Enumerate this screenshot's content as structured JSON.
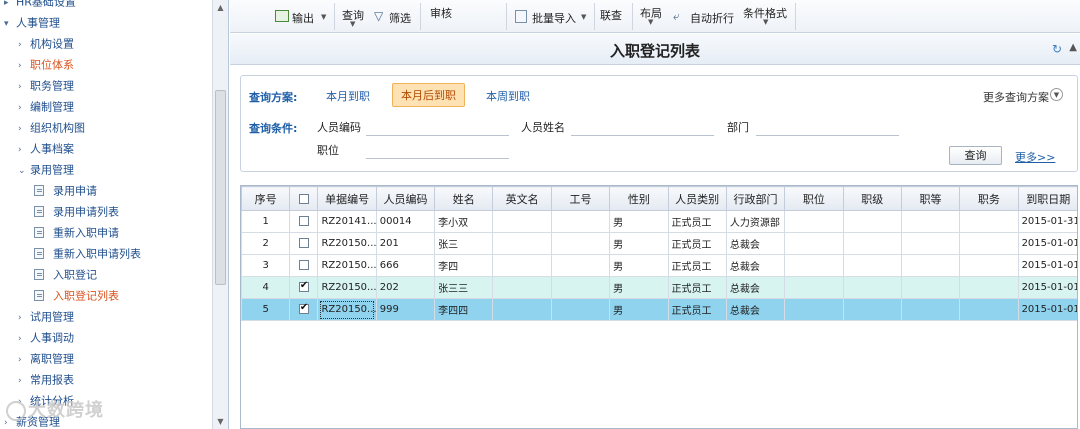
{
  "sidebar": {
    "items": [
      {
        "label": "HR基础设置",
        "level": 0,
        "arrow": "▸",
        "type": "group"
      },
      {
        "label": "人事管理",
        "level": 0,
        "arrow": "▾",
        "type": "group"
      },
      {
        "label": "机构设置",
        "level": 1,
        "arrow": "›",
        "type": "group"
      },
      {
        "label": "职位体系",
        "level": 1,
        "arrow": "›",
        "type": "group",
        "active": true
      },
      {
        "label": "职务管理",
        "level": 1,
        "arrow": "›",
        "type": "group"
      },
      {
        "label": "编制管理",
        "level": 1,
        "arrow": "›",
        "type": "group"
      },
      {
        "label": "组织机构图",
        "level": 1,
        "arrow": "›",
        "type": "group"
      },
      {
        "label": "人事档案",
        "level": 1,
        "arrow": "›",
        "type": "group"
      },
      {
        "label": "录用管理",
        "level": 1,
        "arrow": "⌄",
        "type": "group"
      },
      {
        "label": "录用申请",
        "level": 2,
        "type": "doc"
      },
      {
        "label": "录用申请列表",
        "level": 2,
        "type": "doc"
      },
      {
        "label": "重新入职申请",
        "level": 2,
        "type": "doc"
      },
      {
        "label": "重新入职申请列表",
        "level": 2,
        "type": "doc"
      },
      {
        "label": "入职登记",
        "level": 2,
        "type": "doc"
      },
      {
        "label": "入职登记列表",
        "level": 2,
        "type": "doc",
        "active": true
      },
      {
        "label": "试用管理",
        "level": 1,
        "arrow": "›",
        "type": "group"
      },
      {
        "label": "人事调动",
        "level": 1,
        "arrow": "›",
        "type": "group"
      },
      {
        "label": "离职管理",
        "level": 1,
        "arrow": "›",
        "type": "group"
      },
      {
        "label": "常用报表",
        "level": 1,
        "arrow": "›",
        "type": "group"
      },
      {
        "label": "统计分析",
        "level": 1,
        "arrow": "›",
        "type": "group"
      },
      {
        "label": "薪资管理",
        "level": 0,
        "arrow": "›",
        "type": "group"
      }
    ]
  },
  "watermark": "大数跨境",
  "toolbar": {
    "export": "输出",
    "query": "查询",
    "filter": "筛选",
    "audit": "审核",
    "batch_import": "批量导入",
    "link_query": "联查",
    "layout": "布局",
    "auto_wrap": "自动折行",
    "condition_format": "条件格式"
  },
  "page": {
    "title": "入职登记列表"
  },
  "query": {
    "scheme_label": "查询方案:",
    "schemes": [
      "本月到职",
      "本月后到职",
      "本周到职"
    ],
    "more_schemes": "更多查询方案",
    "condition_label": "查询条件:",
    "fields": {
      "employee_no": "人员编码",
      "employee_name": "人员姓名",
      "department": "部门",
      "position": "职位"
    },
    "query_button": "查询",
    "more_link": "更多>>"
  },
  "grid": {
    "columns": [
      "序号",
      "",
      "单据编号",
      "人员编码",
      "姓名",
      "英文名",
      "工号",
      "性别",
      "人员类别",
      "行政部门",
      "职位",
      "职级",
      "职等",
      "职务",
      "到职日期"
    ],
    "rows": [
      {
        "seq": "1",
        "checked": false,
        "bill_no": "RZ20141...",
        "emp_code": "00014",
        "name": "李小双",
        "en_name": "",
        "work_no": "",
        "gender": "男",
        "category": "正式员工",
        "dept": "人力资源部",
        "position": "",
        "rank": "",
        "grade": "",
        "duty": "",
        "join_date": "2015-01-31"
      },
      {
        "seq": "2",
        "checked": false,
        "bill_no": "RZ20150...",
        "emp_code": "201",
        "name": "张三",
        "en_name": "",
        "work_no": "",
        "gender": "男",
        "category": "正式员工",
        "dept": "总裁会",
        "position": "",
        "rank": "",
        "grade": "",
        "duty": "",
        "join_date": "2015-01-01"
      },
      {
        "seq": "3",
        "checked": false,
        "bill_no": "RZ20150...",
        "emp_code": "666",
        "name": "李四",
        "en_name": "",
        "work_no": "",
        "gender": "男",
        "category": "正式员工",
        "dept": "总裁会",
        "position": "",
        "rank": "",
        "grade": "",
        "duty": "",
        "join_date": "2015-01-01"
      },
      {
        "seq": "4",
        "checked": true,
        "bill_no": "RZ20150...",
        "emp_code": "202",
        "name": "张三三",
        "en_name": "",
        "work_no": "",
        "gender": "男",
        "category": "正式员工",
        "dept": "总裁会",
        "position": "",
        "rank": "",
        "grade": "",
        "duty": "",
        "join_date": "2015-01-01"
      },
      {
        "seq": "5",
        "checked": true,
        "selected": true,
        "bill_no": "RZ20150...",
        "emp_code": "999",
        "name": "李四四",
        "en_name": "",
        "work_no": "",
        "gender": "男",
        "category": "正式员工",
        "dept": "总裁会",
        "position": "",
        "rank": "",
        "grade": "",
        "duty": "",
        "join_date": "2015-01-01"
      }
    ]
  }
}
